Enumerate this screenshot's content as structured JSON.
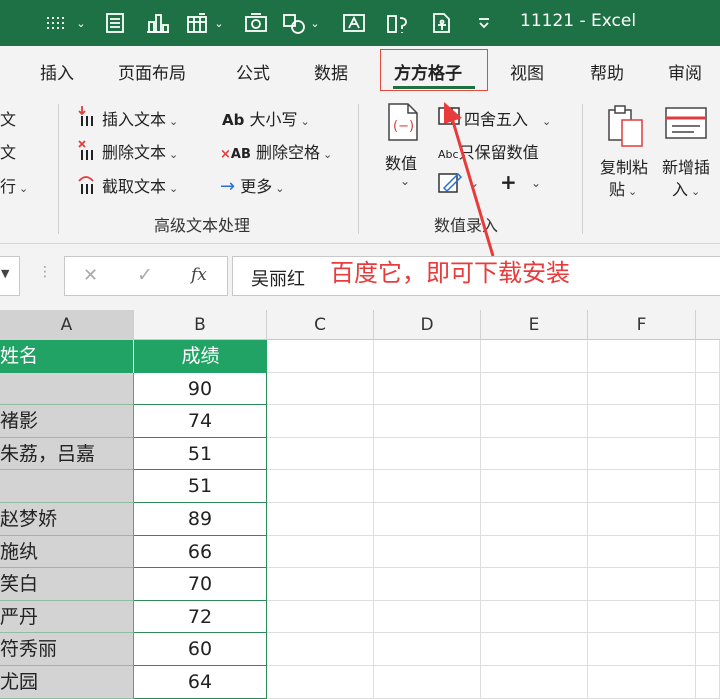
{
  "window": {
    "title": "11121  -  Excel"
  },
  "quick_access": {
    "icons": [
      "dotted-select-icon",
      "chevron-down-icon",
      "form-icon",
      "chart-icon",
      "insert-table-icon",
      "chevron-down-icon",
      "camera-icon",
      "shapes-icon",
      "chevron-down-icon",
      "textbox-icon",
      "image-text-icon",
      "accessibility-icon",
      "customize-icon"
    ]
  },
  "tabs": [
    {
      "label": "插入"
    },
    {
      "label": "页面布局"
    },
    {
      "label": "公式"
    },
    {
      "label": "数据"
    },
    {
      "label": "方方格子",
      "active": true
    },
    {
      "label": "视图"
    },
    {
      "label": "帮助"
    },
    {
      "label": "审阅"
    }
  ],
  "ribbon": {
    "left_partial": [
      "文",
      "文",
      "行"
    ],
    "text_group": {
      "label": "高级文本处理",
      "insert_text": "插入文本",
      "delete_text": "删除文本",
      "extract_text": "截取文本",
      "case": "大小写",
      "delete_space": "删除空格",
      "more": "更多"
    },
    "number_group": {
      "label": "数值录入",
      "value_button": "数值",
      "round": "四舍五入",
      "keep_value": "只保留数值"
    },
    "right_group": {
      "copy_paste_line1": "复制粘",
      "copy_paste_line2": "贴",
      "insert_new_line1": "新增插",
      "insert_new_line2": "入"
    },
    "icon_labels": {
      "ab": "Ab",
      "x_ab": "AB",
      "abc": "Abc",
      "plus": "+"
    }
  },
  "formula_bar": {
    "value": "吴丽红",
    "fx": "fx",
    "cancel": "✕",
    "enter": "✓"
  },
  "annotation": "百度它，即可下载安装",
  "columns": [
    "A",
    "B",
    "C",
    "D",
    "E",
    "F"
  ],
  "sheet": {
    "header": {
      "a": "姓名",
      "b": "成绩"
    },
    "rows": [
      {
        "a": "",
        "b": "90"
      },
      {
        "a": "褚影",
        "b": "74"
      },
      {
        "a": "朱荔，吕嘉",
        "b": "51"
      },
      {
        "a": "",
        "b": "51"
      },
      {
        "a": "赵梦娇",
        "b": "89"
      },
      {
        "a": "施纨",
        "b": "66"
      },
      {
        "a": "笑白",
        "b": "70"
      },
      {
        "a": "严丹",
        "b": "72"
      },
      {
        "a": "符秀丽",
        "b": "60"
      },
      {
        "a": "尤园",
        "b": "64"
      }
    ]
  },
  "colors": {
    "accent": "#1e7145",
    "header_green": "#21a366",
    "annotation_red": "#e83c3c"
  }
}
